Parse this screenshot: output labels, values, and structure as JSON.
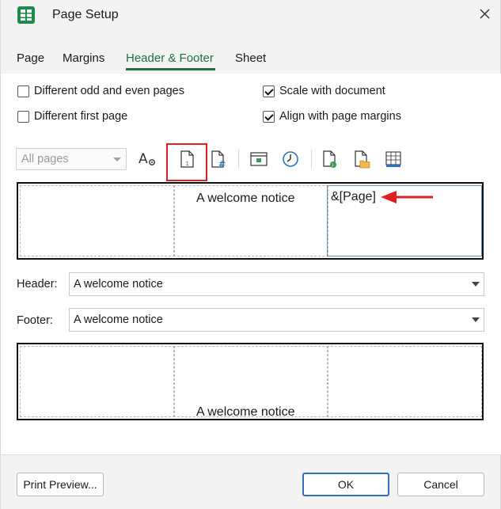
{
  "window": {
    "title": "Page Setup"
  },
  "tabs": [
    {
      "label": "Page"
    },
    {
      "label": "Margins"
    },
    {
      "label": "Header & Footer",
      "active": true
    },
    {
      "label": "Sheet"
    }
  ],
  "options": {
    "different_odd_even": {
      "label": "Different odd and even pages",
      "checked": false
    },
    "different_first": {
      "label": "Different first page",
      "checked": false
    },
    "scale_with_document": {
      "label": "Scale with document",
      "checked": true
    },
    "align_with_margins": {
      "label": "Align with page margins",
      "checked": true
    }
  },
  "toolbar": {
    "pages_select": "All pages",
    "icons": [
      "format-text-icon",
      "insert-page-number-icon",
      "insert-page-count-icon",
      "insert-date-icon",
      "insert-time-icon",
      "insert-file-path-icon",
      "insert-file-name-icon",
      "insert-sheet-name-icon"
    ]
  },
  "header_preview": {
    "left": "",
    "center": "A welcome notice",
    "right": "&[Page]"
  },
  "header": {
    "label": "Header:",
    "value": "A welcome notice"
  },
  "footer": {
    "label": "Footer:",
    "value": "A welcome notice"
  },
  "footer_preview": {
    "left": "",
    "center": "A welcome notice",
    "right": ""
  },
  "buttons": {
    "print_preview": "Print Preview...",
    "ok": "OK",
    "cancel": "Cancel"
  },
  "colors": {
    "accent": "#1f6f43",
    "highlight": "#e02020",
    "ok_border": "#2f6fbf"
  }
}
